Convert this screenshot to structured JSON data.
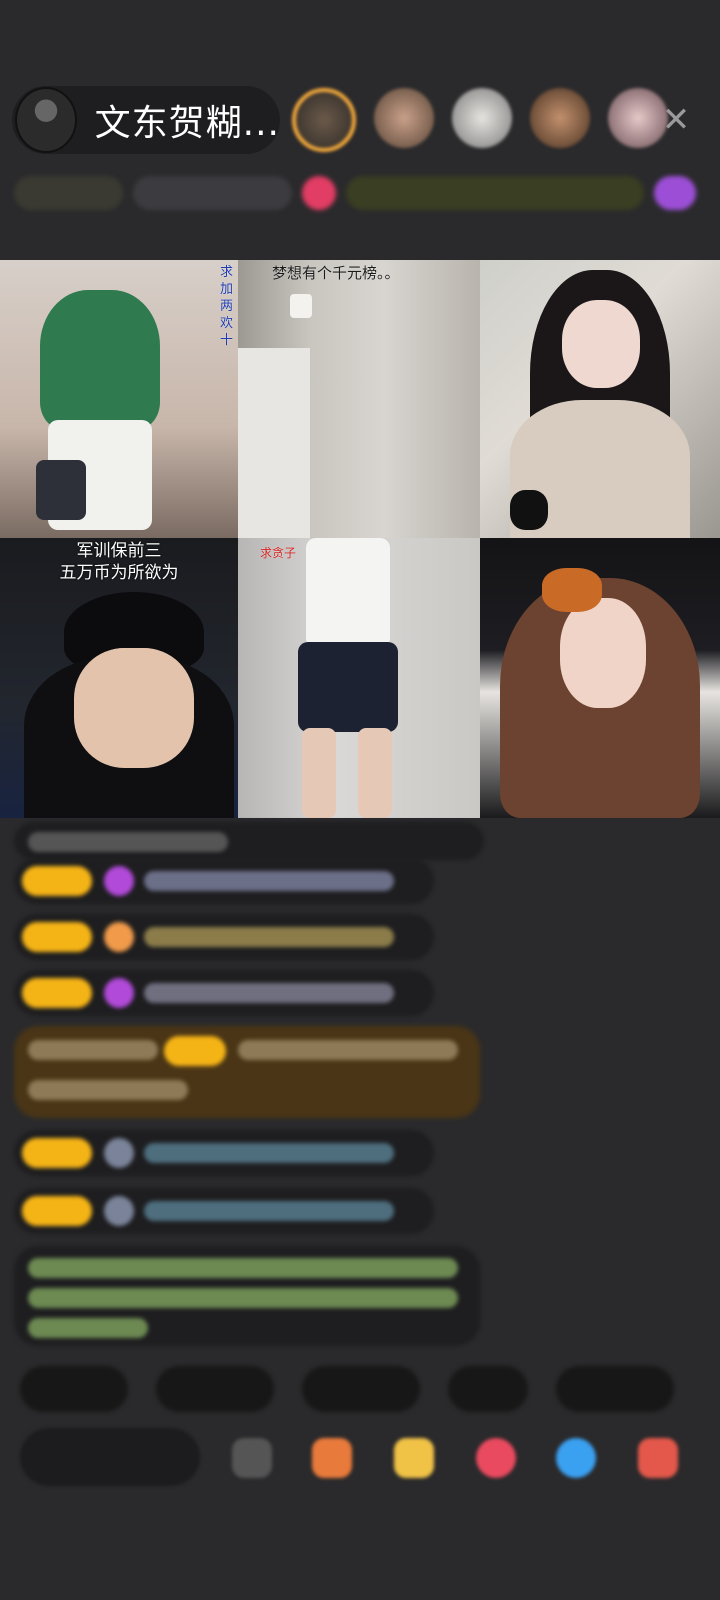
{
  "header": {
    "host_name": "文东贺糊...",
    "close_icon": "close-icon",
    "colors": {
      "level_badge": "#f5b416",
      "frame_gold": "#f3a93b"
    }
  },
  "video_grid": {
    "tiles": [
      {
        "caption": "",
        "side_text": "求加两欢十"
      },
      {
        "caption": "梦想有个千元榜。。"
      },
      {
        "caption": ""
      },
      {
        "caption_line1": "军训保前三",
        "caption_line2": "五万币为所欲为"
      },
      {
        "caption": "求贪子"
      },
      {
        "caption": ""
      }
    ]
  }
}
